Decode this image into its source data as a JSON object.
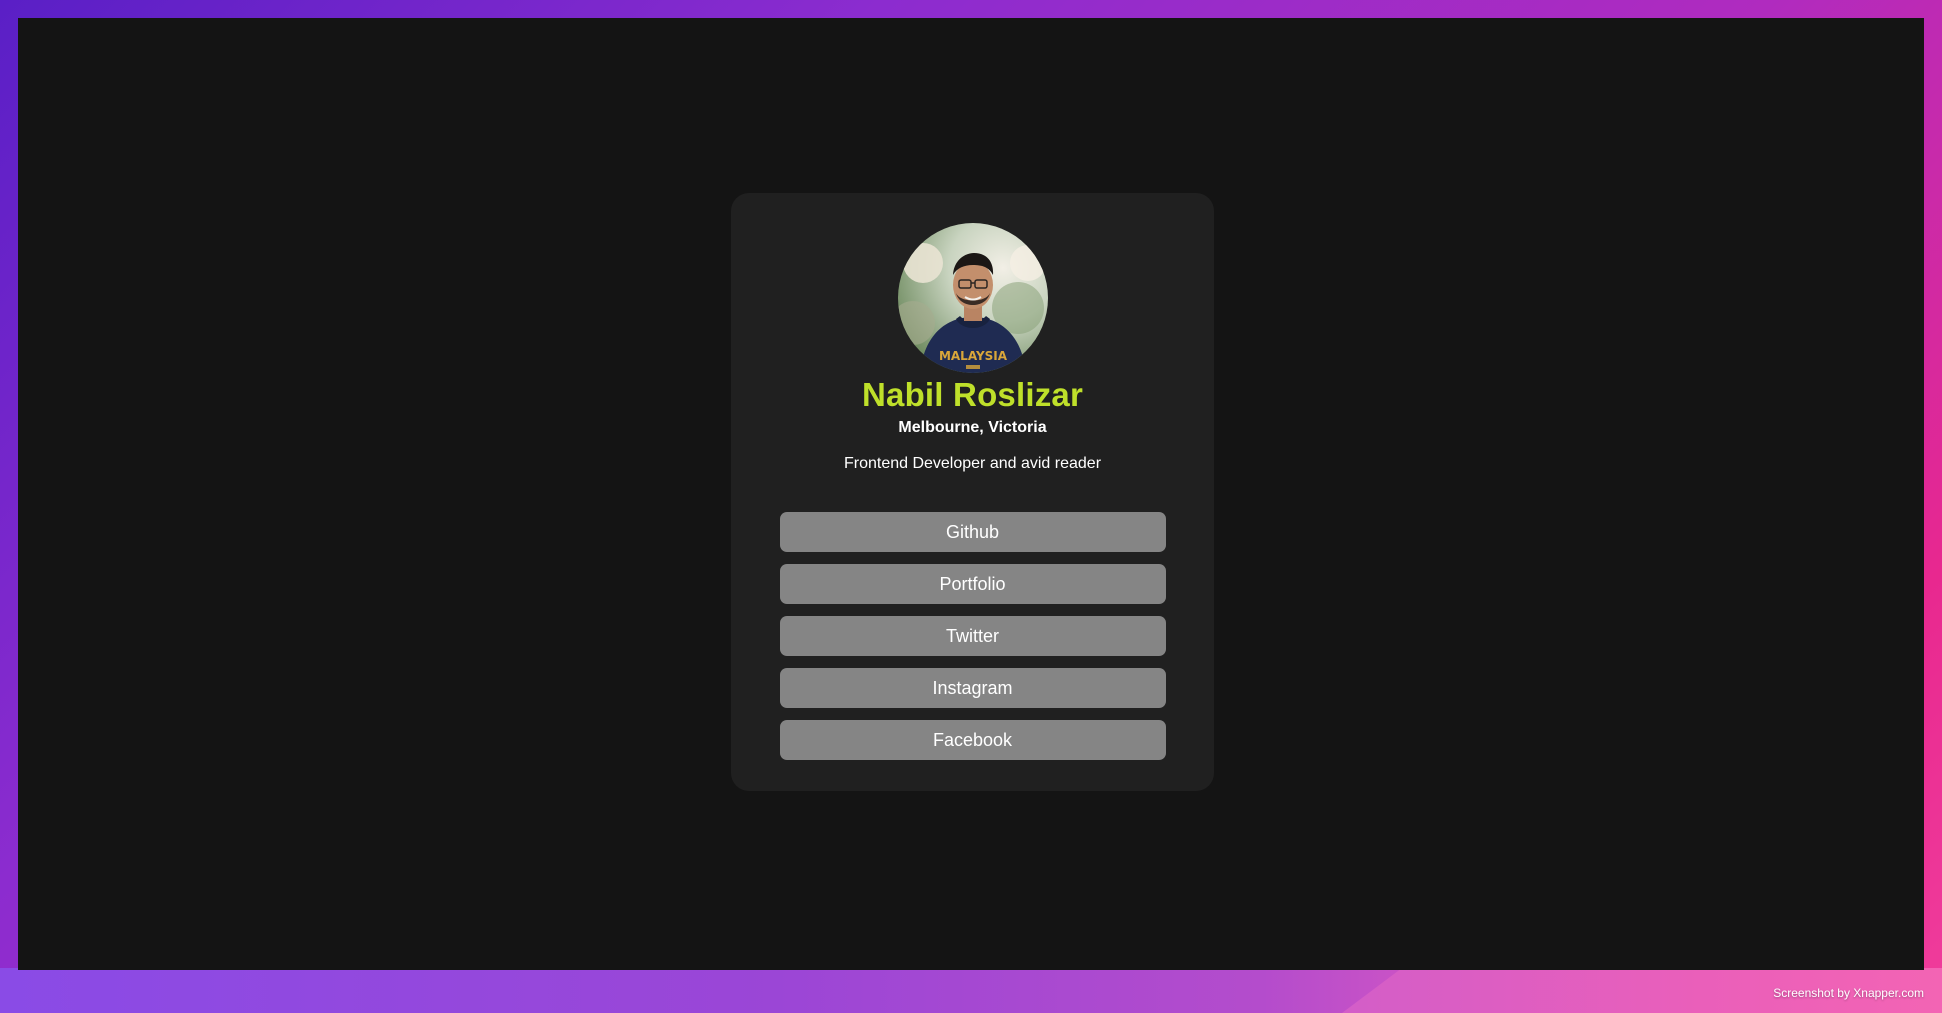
{
  "colors": {
    "screen_bg": "#141414",
    "card_bg": "#202020",
    "name_accent": "#bfe02a",
    "button_bg": "#858585",
    "text": "#ffffff"
  },
  "profile": {
    "avatar_icon": "profile-photo",
    "avatar_shirt_text": "MALAYSIA",
    "name": "Nabil Roslizar",
    "location": "Melbourne, Victoria",
    "bio": "Frontend Developer and avid reader"
  },
  "links": [
    {
      "label": "Github"
    },
    {
      "label": "Portfolio"
    },
    {
      "label": "Twitter"
    },
    {
      "label": "Instagram"
    },
    {
      "label": "Facebook"
    }
  ],
  "footer": {
    "credit": "Screenshot by Xnapper.com"
  }
}
